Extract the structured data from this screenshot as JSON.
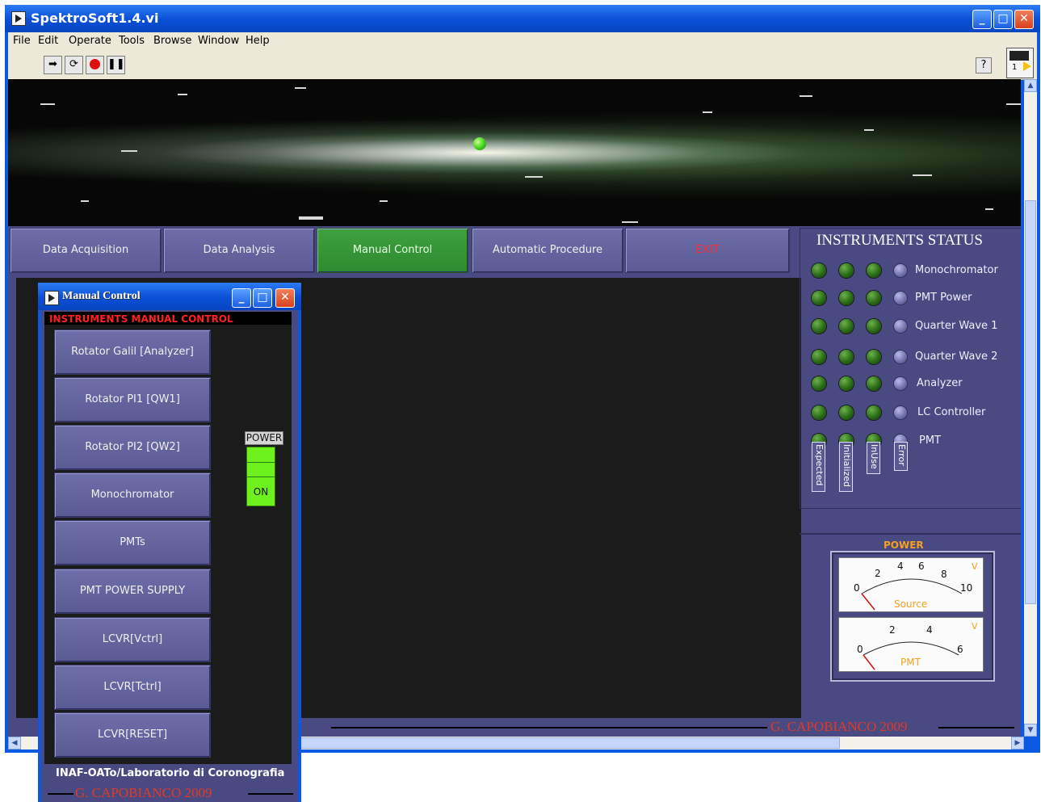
{
  "window": {
    "title": "SpektroSoft1.4.vi",
    "menu": [
      "File",
      "Edit",
      "Operate",
      "Tools",
      "Browse",
      "Window",
      "Help"
    ],
    "toolbar_icons": [
      "run-arrow-icon",
      "run-continuous-icon",
      "abort-icon",
      "pause-icon"
    ],
    "help_label": "?",
    "connector_number": "1"
  },
  "nav": {
    "buttons": [
      {
        "label": "Data Acquisition"
      },
      {
        "label": "Data Analysis"
      },
      {
        "label": "Manual Control",
        "active": true
      },
      {
        "label": "Automatic Procedure"
      },
      {
        "label": "EXIT",
        "color": "#ff2a2a"
      }
    ]
  },
  "status": {
    "title": "INSTRUMENTS STATUS",
    "instruments": [
      "Monochromator",
      "PMT Power",
      "Quarter Wave 1",
      "Quarter Wave 2",
      "Analyzer",
      "LC Controller",
      "PMT"
    ],
    "columns": [
      "Expected",
      "Initialized",
      "InUse",
      "Error"
    ]
  },
  "power": {
    "title": "POWER",
    "source_meter": {
      "name": "Source",
      "unit": "V",
      "ticks": [
        "0",
        "2",
        "4",
        "6",
        "8",
        "10"
      ],
      "value": 0
    },
    "pmt_meter": {
      "name": "PMT",
      "unit": "V",
      "ticks": [
        "0",
        "2",
        "4",
        "6"
      ],
      "value": 0
    }
  },
  "credit": "G. CAPOBIANCO 2009",
  "manual_control": {
    "title": "Manual Control",
    "header": "INSTRUMENTS MANUAL CONTROL",
    "buttons": [
      "Rotator Galil [Analyzer]",
      "Rotator PI1 [QW1]",
      "Rotator PI2 [QW2]",
      "Monochromator",
      "PMTs",
      "PMT POWER SUPPLY",
      "LCVR[Vctrl]",
      "LCVR[Tctrl]",
      "LCVR[RESET]"
    ],
    "power_label": "POWER",
    "power_state": "ON",
    "footer": "INAF-OATo/Laboratorio di Coronografia",
    "credit": "G. CAPOBIANCO 2009"
  },
  "colors": {
    "panel_bg": "#4a4a82",
    "active_button": "#3ea13e",
    "exit_text": "#ff2a2a",
    "led_on_green": "#2a6a17",
    "credit": "#e03a24",
    "power_on": "#6ef01c"
  }
}
